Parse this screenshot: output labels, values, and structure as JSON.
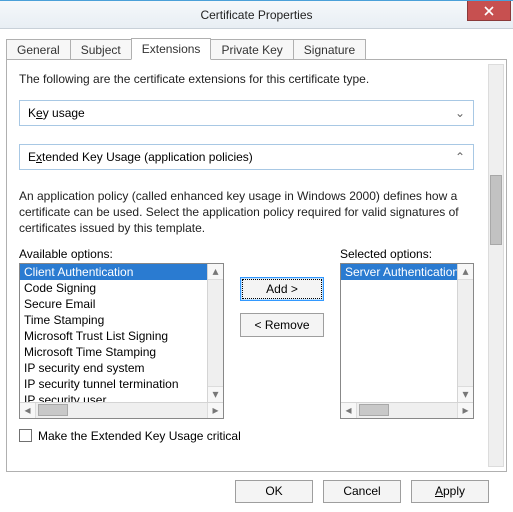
{
  "title": "Certificate Properties",
  "tabs": {
    "general": "General",
    "subject": "Subject",
    "extensions": "Extensions",
    "privatekey": "Private Key",
    "signature": "Signature"
  },
  "intro": "The following are the certificate extensions for this certificate type.",
  "key_usage": {
    "label_pre": "K",
    "label_u": "e",
    "label_post": "y usage"
  },
  "eku_header": {
    "label_pre": "E",
    "label_u": "x",
    "label_post": "tended Key Usage (application policies)"
  },
  "eku_desc": "An application policy (called enhanced key usage in Windows 2000) defines how a certificate can be used. Select the application policy required for valid signatures of certificates issued by this template.",
  "available_label": "Available options:",
  "selected_label": "Selected options:",
  "available": [
    "Client Authentication",
    "Code Signing",
    "Secure Email",
    "Time Stamping",
    "Microsoft Trust List Signing",
    "Microsoft Time Stamping",
    "IP security end system",
    "IP security tunnel termination",
    "IP security user"
  ],
  "selected": [
    "Server Authentication"
  ],
  "buttons": {
    "add": "Add >",
    "remove": "< Remove",
    "ok": "OK",
    "cancel": "Cancel",
    "apply_pre": "",
    "apply_u": "A",
    "apply_post": "pply"
  },
  "critical_label": "Make the Extended Key Usage critical"
}
